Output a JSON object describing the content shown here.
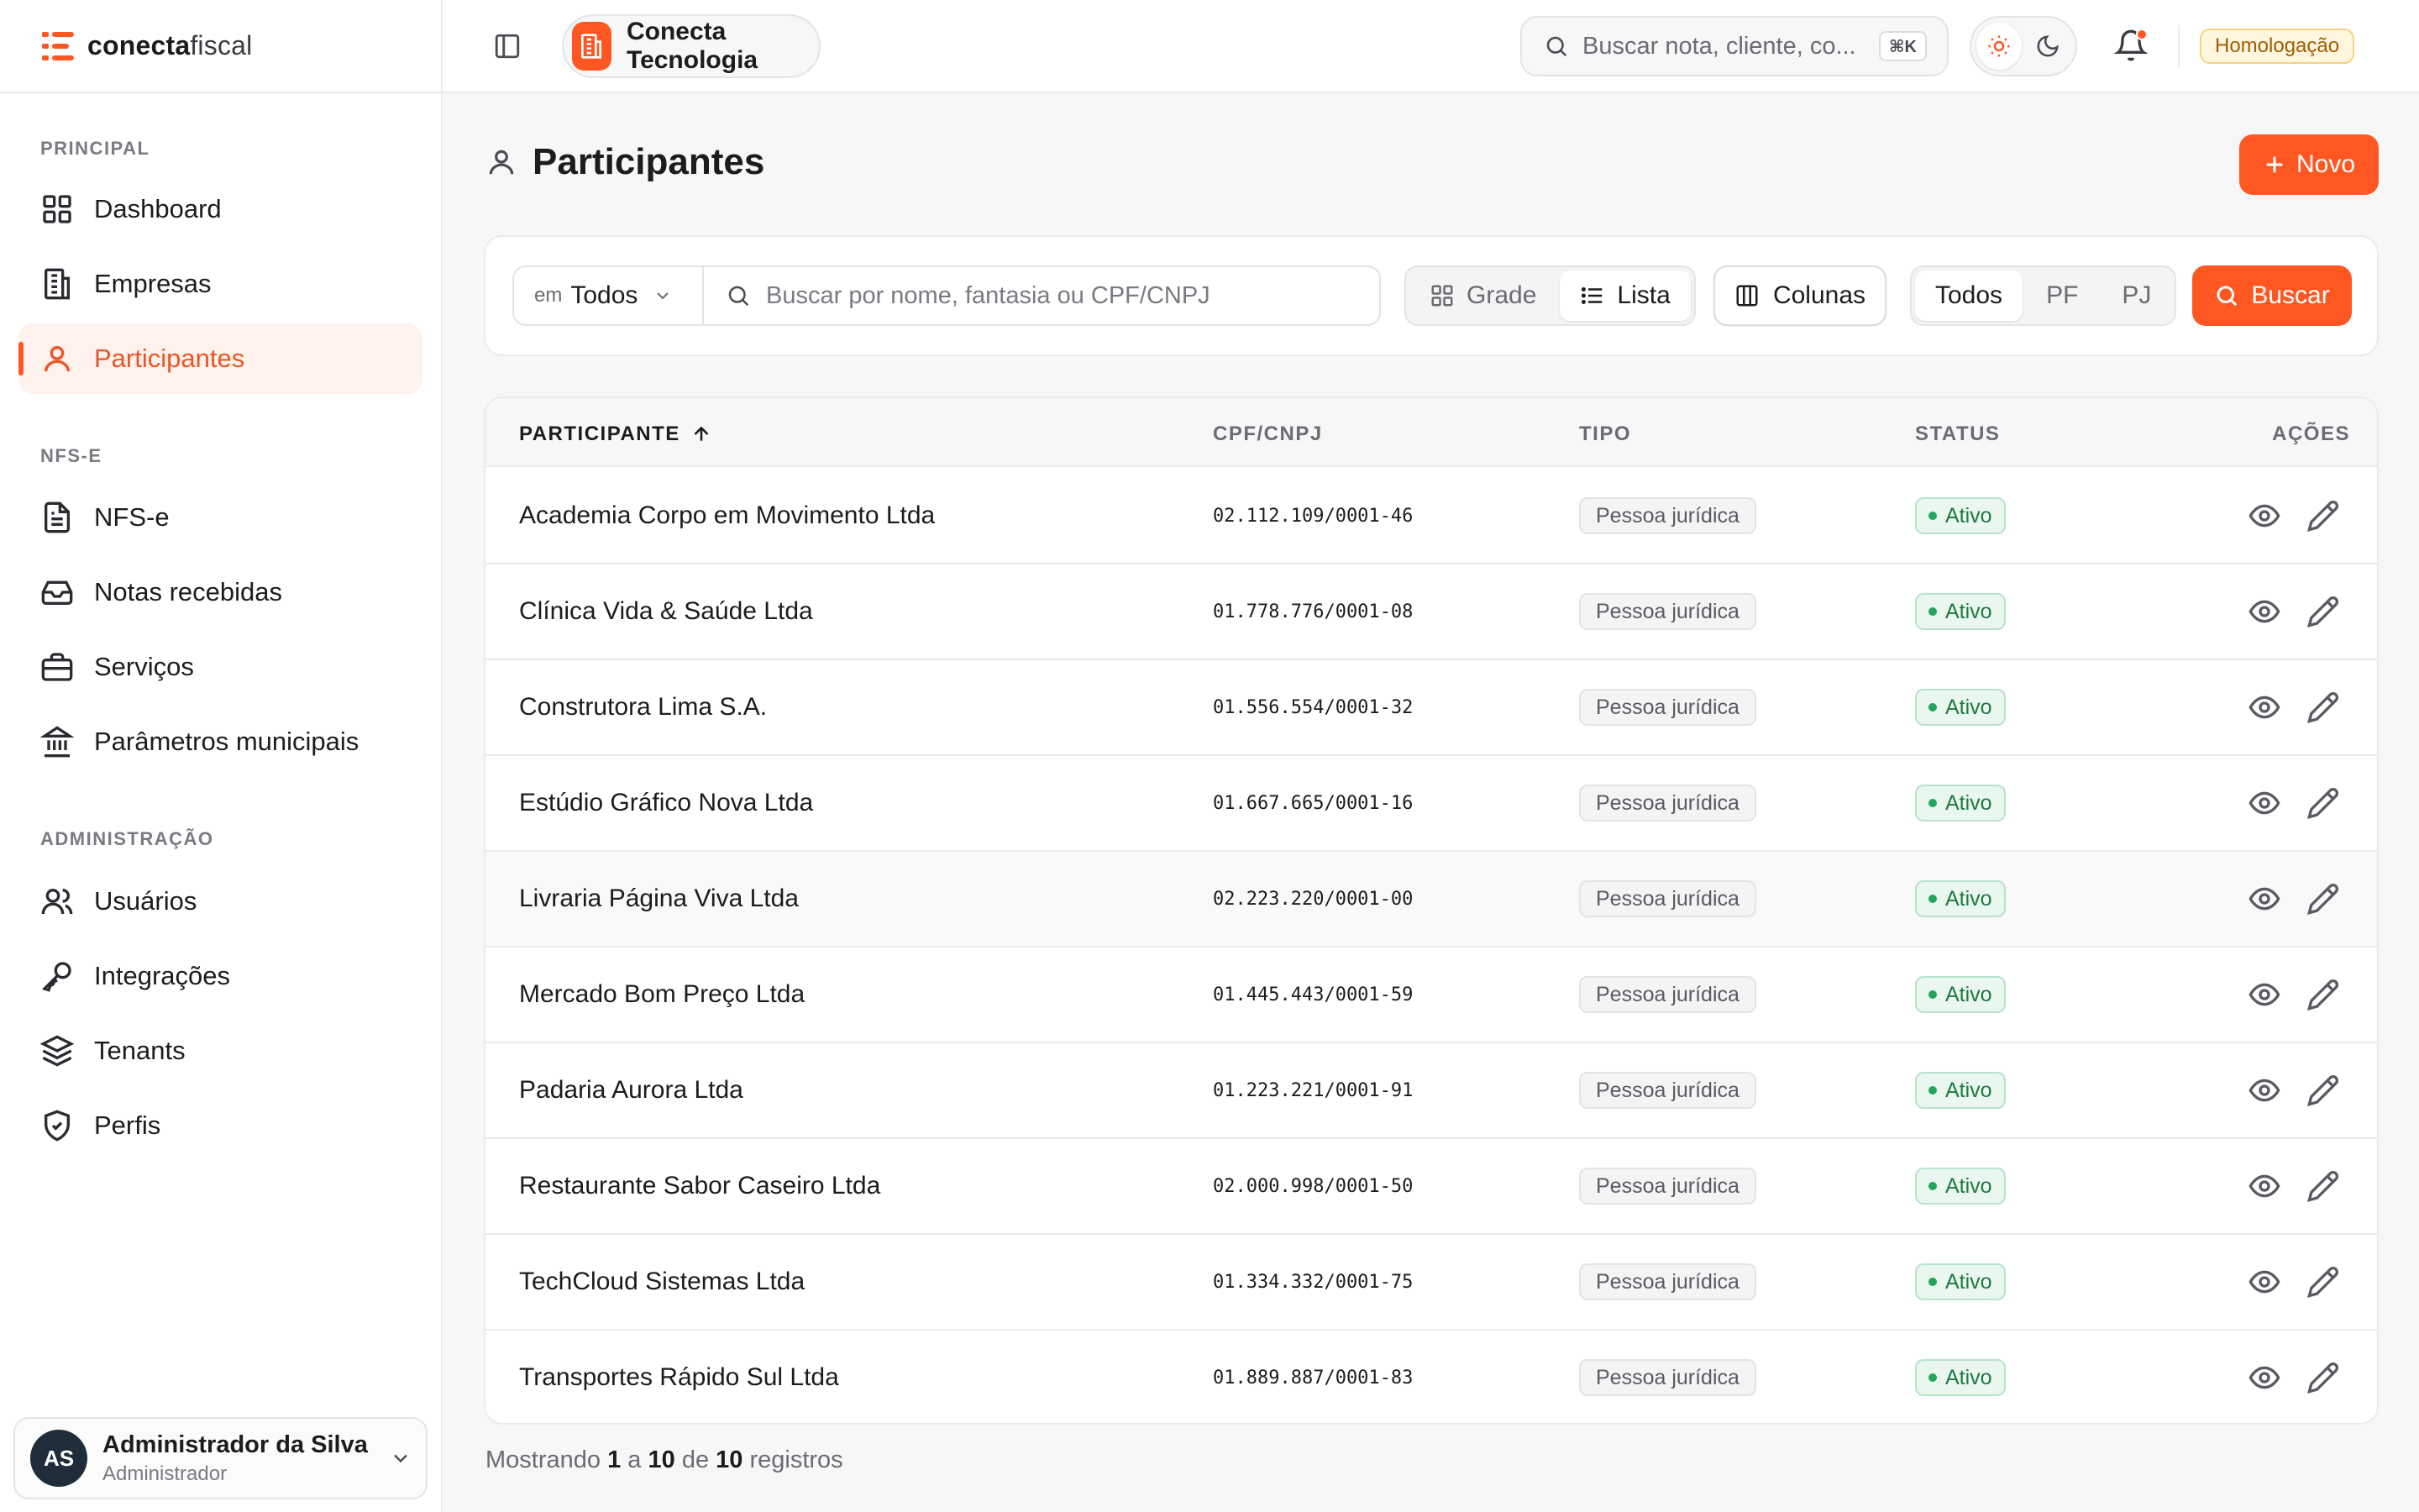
{
  "brand": {
    "name_bold": "conecta",
    "name_light": "fiscal"
  },
  "sidebar": {
    "sections": [
      {
        "title": "PRINCIPAL"
      },
      {
        "title": "NFS-E"
      },
      {
        "title": "ADMINISTRAÇÃO"
      }
    ],
    "items": [
      {
        "label": "Dashboard",
        "icon": "grid-icon"
      },
      {
        "label": "Empresas",
        "icon": "building-icon"
      },
      {
        "label": "Participantes",
        "icon": "user-icon",
        "active": true
      },
      {
        "label": "NFS-e",
        "icon": "document-icon"
      },
      {
        "label": "Notas recebidas",
        "icon": "inbox-icon"
      },
      {
        "label": "Serviços",
        "icon": "briefcase-icon"
      },
      {
        "label": "Parâmetros municipais",
        "icon": "landmark-icon"
      },
      {
        "label": "Usuários",
        "icon": "users-icon"
      },
      {
        "label": "Integrações",
        "icon": "key-icon"
      },
      {
        "label": "Tenants",
        "icon": "layers-icon"
      },
      {
        "label": "Perfis",
        "icon": "shield-icon"
      }
    ],
    "user": {
      "initials": "AS",
      "name": "Administrador da Silva",
      "role": "Administrador"
    }
  },
  "topbar": {
    "company": "Conecta Tecnologia",
    "search_placeholder": "Buscar nota, cliente, co...",
    "shortcut": "⌘K",
    "environment": "Homologação"
  },
  "page": {
    "title": "Participantes",
    "new_button": "Novo"
  },
  "filters": {
    "scope_prefix": "em",
    "scope_value": "Todos",
    "search_placeholder": "Buscar por nome, fantasia ou CPF/CNPJ",
    "view_grid": "Grade",
    "view_list": "Lista",
    "columns_button": "Colunas",
    "type_all": "Todos",
    "type_pf": "PF",
    "type_pj": "PJ",
    "search_button": "Buscar"
  },
  "table": {
    "headers": {
      "participant": "PARTICIPANTE",
      "doc": "CPF/CNPJ",
      "type": "TIPO",
      "status": "STATUS",
      "actions": "AÇÕES"
    },
    "rows": [
      {
        "name": "Academia Corpo em Movimento Ltda",
        "doc": "02.112.109/0001-46",
        "type": "Pessoa jurídica",
        "status": "Ativo"
      },
      {
        "name": "Clínica Vida & Saúde Ltda",
        "doc": "01.778.776/0001-08",
        "type": "Pessoa jurídica",
        "status": "Ativo"
      },
      {
        "name": "Construtora Lima S.A.",
        "doc": "01.556.554/0001-32",
        "type": "Pessoa jurídica",
        "status": "Ativo"
      },
      {
        "name": "Estúdio Gráfico Nova Ltda",
        "doc": "01.667.665/0001-16",
        "type": "Pessoa jurídica",
        "status": "Ativo"
      },
      {
        "name": "Livraria Página Viva Ltda",
        "doc": "02.223.220/0001-00",
        "type": "Pessoa jurídica",
        "status": "Ativo"
      },
      {
        "name": "Mercado Bom Preço Ltda",
        "doc": "01.445.443/0001-59",
        "type": "Pessoa jurídica",
        "status": "Ativo"
      },
      {
        "name": "Padaria Aurora Ltda",
        "doc": "01.223.221/0001-91",
        "type": "Pessoa jurídica",
        "status": "Ativo"
      },
      {
        "name": "Restaurante Sabor Caseiro Ltda",
        "doc": "02.000.998/0001-50",
        "type": "Pessoa jurídica",
        "status": "Ativo"
      },
      {
        "name": "TechCloud Sistemas Ltda",
        "doc": "01.334.332/0001-75",
        "type": "Pessoa jurídica",
        "status": "Ativo"
      },
      {
        "name": "Transportes Rápido Sul Ltda",
        "doc": "01.889.887/0001-83",
        "type": "Pessoa jurídica",
        "status": "Ativo"
      }
    ]
  },
  "footer": {
    "prefix": "Mostrando",
    "from": "1",
    "sep_a": "a",
    "to": "10",
    "sep_de": "de",
    "total": "10",
    "suffix": "registros"
  },
  "colors": {
    "accent": "#ff5722",
    "status_green": "#1d7a44"
  }
}
